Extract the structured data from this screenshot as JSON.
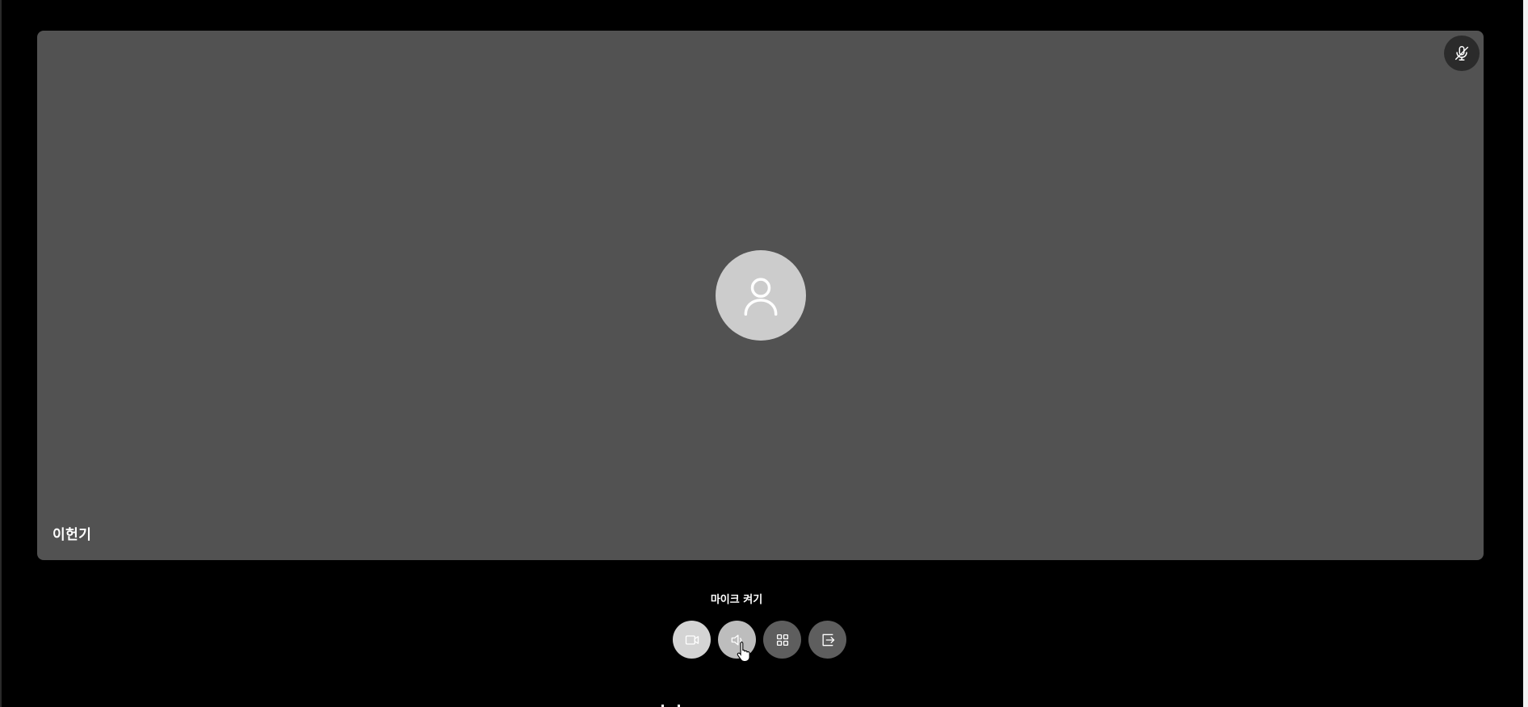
{
  "participant": {
    "name": "이헌기",
    "mic_status_icon": "mic-off-icon",
    "avatar_icon": "user-icon"
  },
  "tooltip": {
    "text": "마이크 켜기"
  },
  "controls": [
    {
      "name": "camera-toggle-button",
      "icon": "video-camera-icon"
    },
    {
      "name": "mic-toggle-button",
      "icon": "speaker-icon"
    },
    {
      "name": "layout-grid-button",
      "icon": "grid-icon"
    },
    {
      "name": "leave-button",
      "icon": "exit-icon"
    }
  ],
  "colors": {
    "background": "#000000",
    "tile": "#525252",
    "avatar": "#cccccc",
    "control_light": "#d4d4d4",
    "control_dark": "#5e5e5e"
  }
}
